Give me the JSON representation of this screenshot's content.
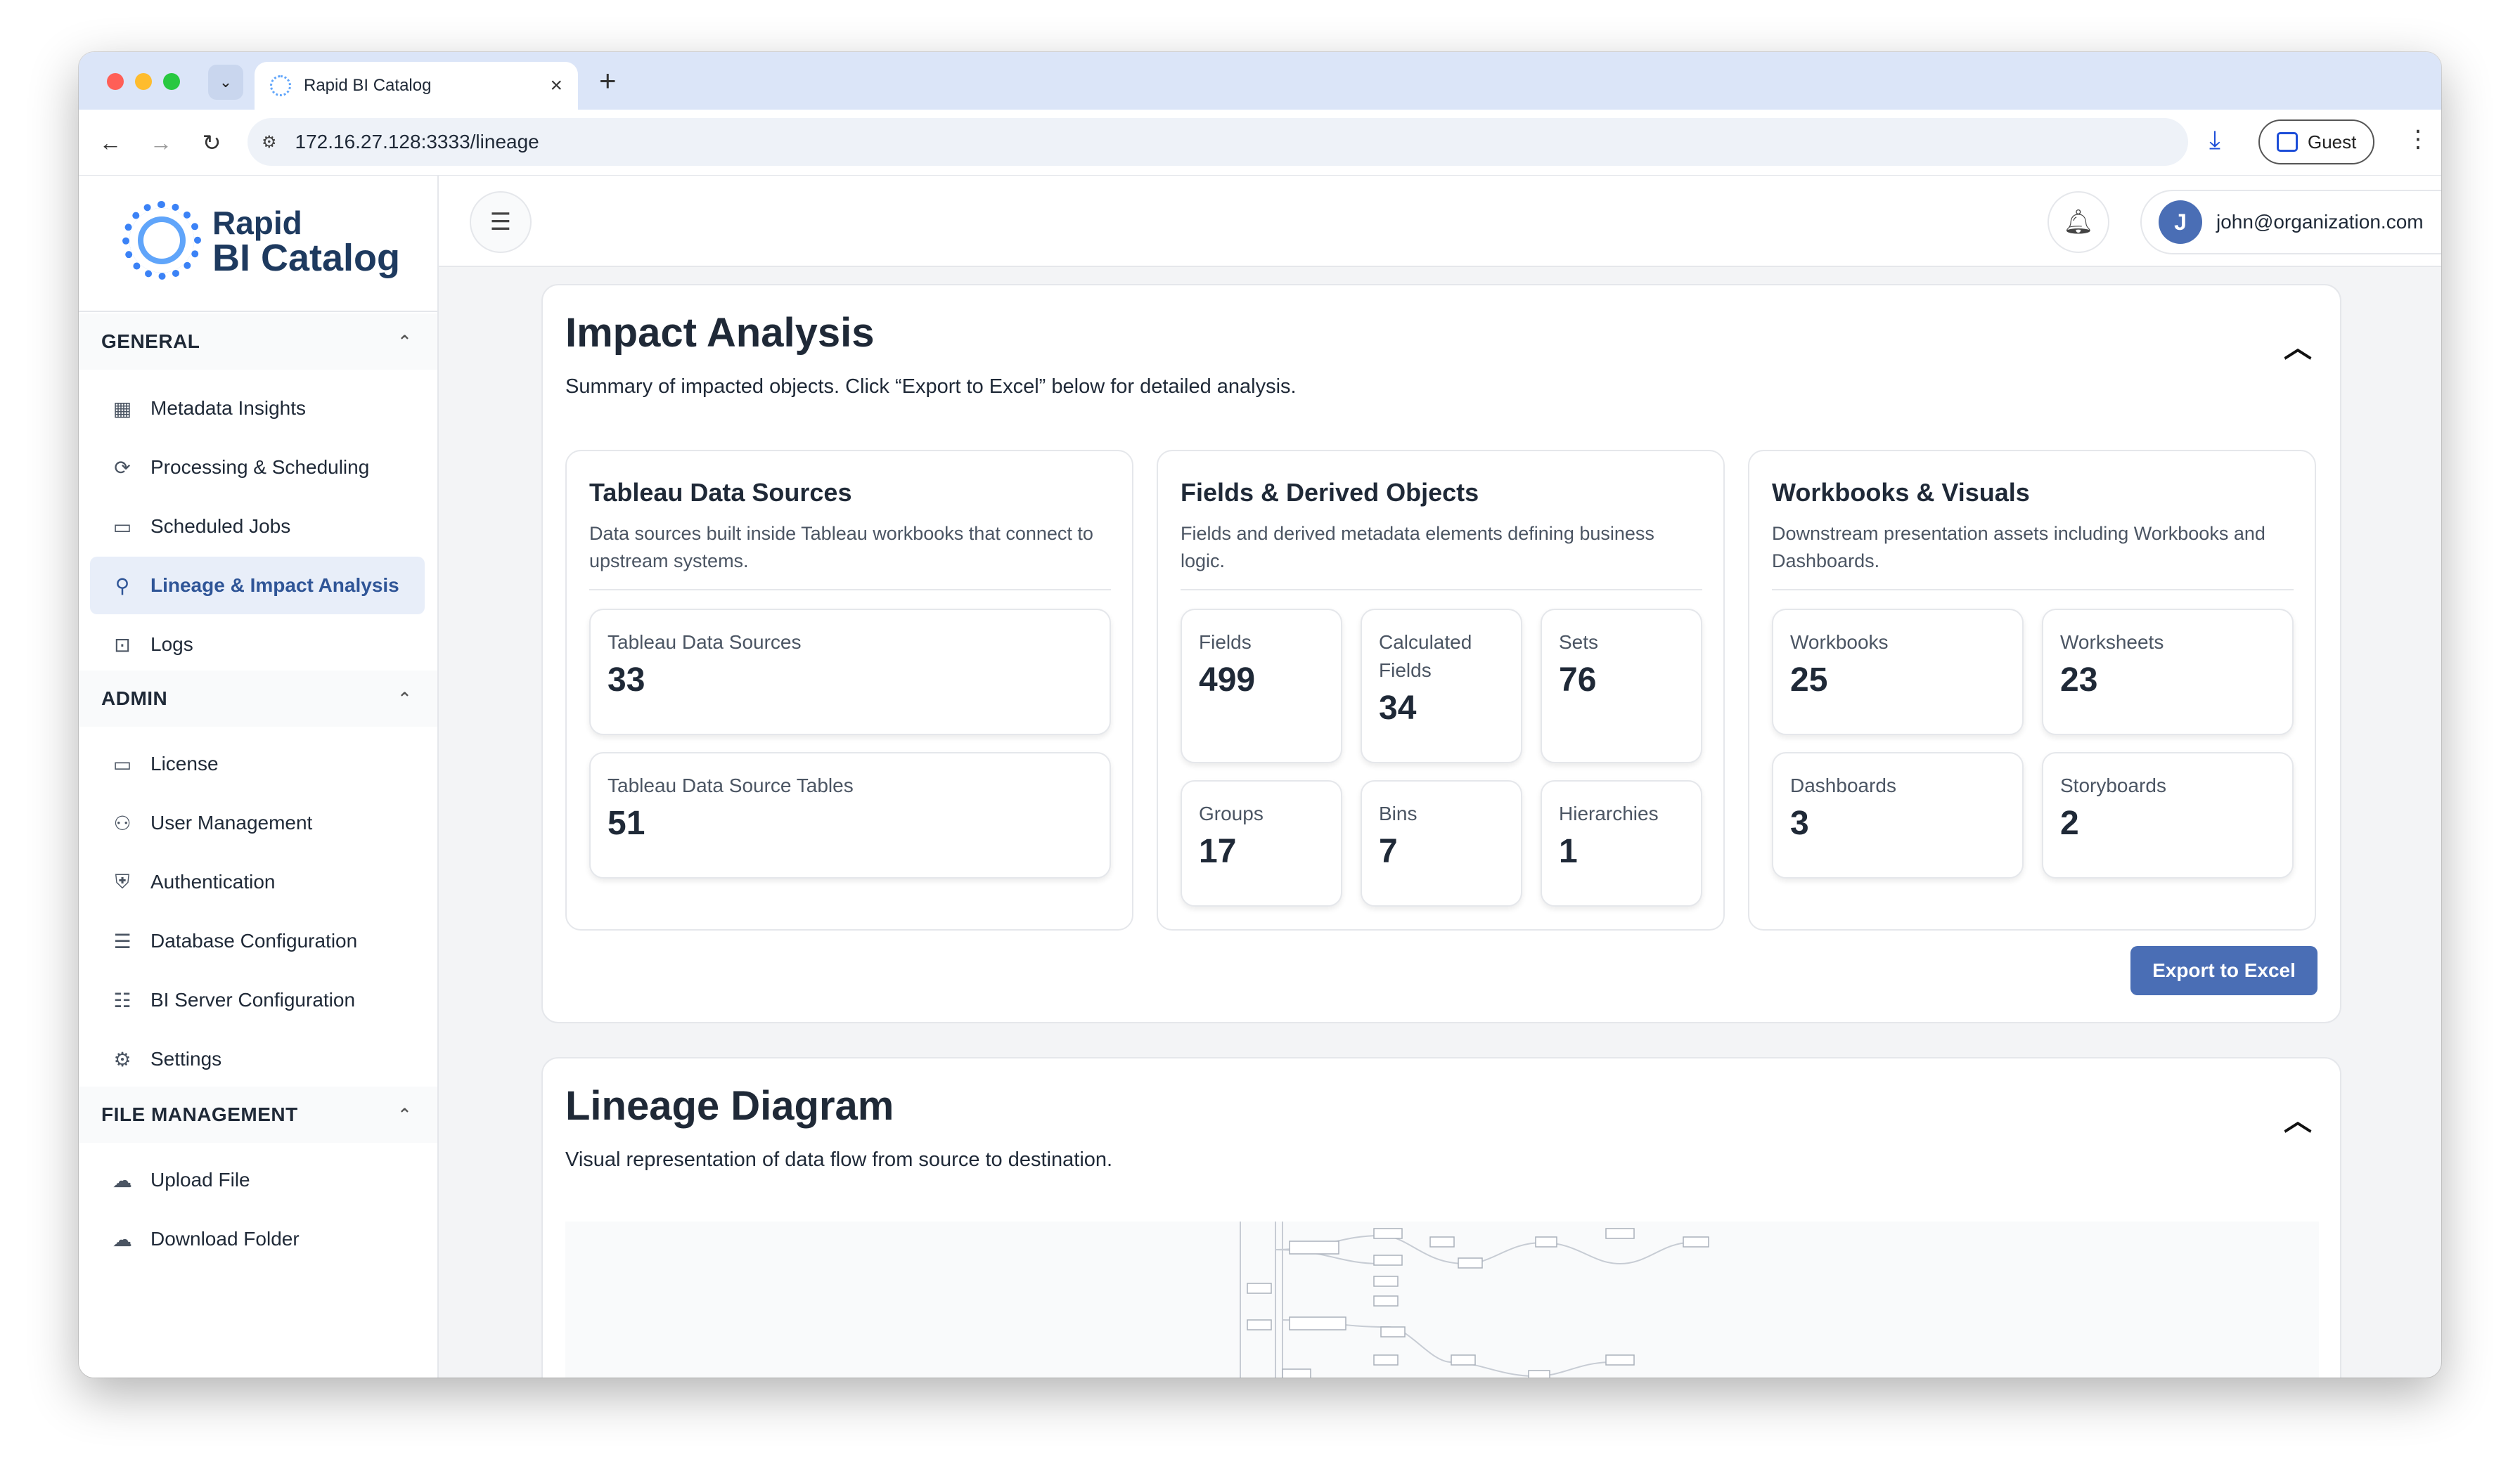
{
  "browser": {
    "tab_title": "Rapid BI Catalog",
    "url": "172.16.27.128:3333/lineage",
    "profile_label": "Guest"
  },
  "brand": {
    "line1": "Rapid",
    "line2": "BI Catalog"
  },
  "sidebar": {
    "sections": [
      {
        "title": "GENERAL",
        "items": [
          {
            "label": "Metadata Insights",
            "icon": "grid-icon"
          },
          {
            "label": "Processing & Scheduling",
            "icon": "refresh-icon"
          },
          {
            "label": "Scheduled Jobs",
            "icon": "calendar-icon"
          },
          {
            "label": "Lineage & Impact Analysis",
            "icon": "lineage-icon",
            "active": true
          },
          {
            "label": "Logs",
            "icon": "terminal-icon"
          }
        ]
      },
      {
        "title": "ADMIN",
        "items": [
          {
            "label": "License",
            "icon": "ticket-icon"
          },
          {
            "label": "User Management",
            "icon": "users-icon"
          },
          {
            "label": "Authentication",
            "icon": "shield-icon"
          },
          {
            "label": "Database Configuration",
            "icon": "database-icon"
          },
          {
            "label": "BI Server Configuration",
            "icon": "server-icon"
          },
          {
            "label": "Settings",
            "icon": "gear-icon"
          }
        ]
      },
      {
        "title": "FILE MANAGEMENT",
        "items": [
          {
            "label": "Upload File",
            "icon": "cloud-upload-icon"
          },
          {
            "label": "Download Folder",
            "icon": "cloud-download-icon"
          }
        ]
      }
    ]
  },
  "topbar": {
    "avatar_initial": "J",
    "user_email": "john@organization.com"
  },
  "impact": {
    "title": "Impact Analysis",
    "subtitle": "Summary of impacted objects. Click “Export to Excel” below for detailed analysis.",
    "groups": [
      {
        "title": "Tableau Data Sources",
        "description": "Data sources built inside Tableau workbooks that connect to upstream systems.",
        "metrics": [
          {
            "label": "Tableau Data Sources",
            "value": "33"
          },
          {
            "label": "Tableau Data Source Tables",
            "value": "51"
          }
        ]
      },
      {
        "title": "Fields & Derived Objects",
        "description": "Fields and derived metadata elements defining business logic.",
        "metrics": [
          {
            "label": "Fields",
            "value": "499"
          },
          {
            "label": "Calculated Fields",
            "value": "34"
          },
          {
            "label": "Sets",
            "value": "76"
          },
          {
            "label": "Groups",
            "value": "17"
          },
          {
            "label": "Bins",
            "value": "7"
          },
          {
            "label": "Hierarchies",
            "value": "1"
          }
        ]
      },
      {
        "title": "Workbooks & Visuals",
        "description": "Downstream presentation assets including Workbooks and Dashboards.",
        "metrics": [
          {
            "label": "Workbooks",
            "value": "25"
          },
          {
            "label": "Worksheets",
            "value": "23"
          },
          {
            "label": "Dashboards",
            "value": "3"
          },
          {
            "label": "Storyboards",
            "value": "2"
          }
        ]
      }
    ],
    "export_label": "Export to Excel"
  },
  "lineage": {
    "title": "Lineage Diagram",
    "subtitle": "Visual representation of data flow from source to destination."
  },
  "colors": {
    "accent": "#4a6eb5",
    "active_bg": "#e8eef9",
    "brand_text": "#1e3a5f"
  }
}
